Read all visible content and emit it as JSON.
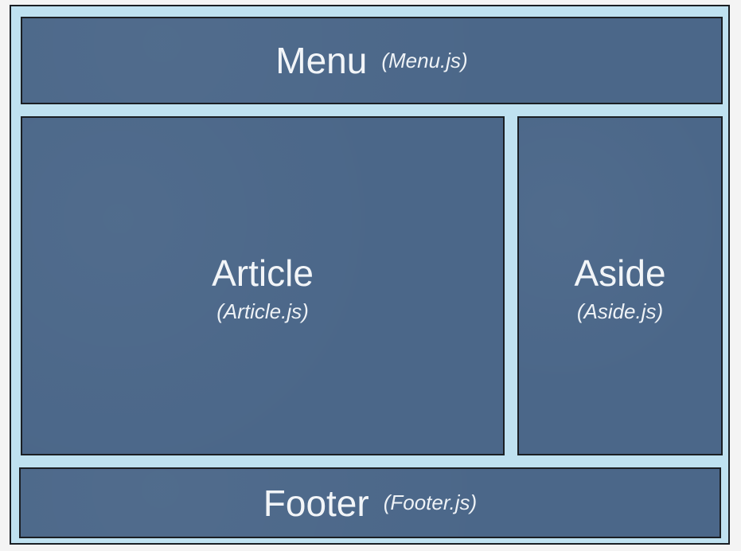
{
  "regions": {
    "menu": {
      "name": "Menu",
      "file": "(Menu.js)"
    },
    "article": {
      "name": "Article",
      "file": "(Article.js)"
    },
    "aside": {
      "name": "Aside",
      "file": "(Aside.js)"
    },
    "footer": {
      "name": "Footer",
      "file": "(Footer.js)"
    }
  },
  "colors": {
    "panel_fill": "#4b6789",
    "frame_fill": "#bfe1f0",
    "border": "#1b1f24",
    "text": "#f2f5f8"
  }
}
